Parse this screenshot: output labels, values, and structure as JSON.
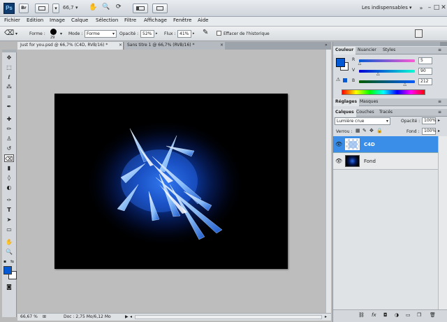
{
  "app": {
    "logo_text": "Ps"
  },
  "appbar": {
    "zoom": "66,7",
    "workspace": "Les indispensables"
  },
  "menu": [
    "Fichier",
    "Edition",
    "Image",
    "Calque",
    "Sélection",
    "Filtre",
    "Affichage",
    "Fenêtre",
    "Aide"
  ],
  "options": {
    "forme_label": "Forme :",
    "brush_size": "29",
    "mode_label": "Mode :",
    "mode_value": "Forme",
    "opacite_label": "Opacité :",
    "opacite_value": "52%",
    "flux_label": "Flux :",
    "flux_value": "41%",
    "historique_label": "Effacer de l'historique"
  },
  "tabs": [
    {
      "label": "Just for you.psd @ 66,7% (C4D, RVB/16) *",
      "active": true
    },
    {
      "label": "Sans titre 1 @ 66,7% (RVB/16) *",
      "active": false
    }
  ],
  "status": {
    "zoom": "66,67 %",
    "doc": "Doc : 2,75 Mo/6,12 Mo"
  },
  "color_panel": {
    "tabs": [
      "Couleur",
      "Nuancier",
      "Styles"
    ],
    "r_label": "R",
    "v_label": "V",
    "b_label": "B",
    "r": "5",
    "v": "90",
    "b": "212",
    "r_level": 0.02,
    "v_level": 0.35,
    "b_level": 0.83,
    "foreground": "#055ad4",
    "background": "#ffffff"
  },
  "adjust_panel": {
    "tabs": [
      "Réglages",
      "Masques"
    ]
  },
  "layers_panel": {
    "tabs": [
      "Calques",
      "Couches",
      "Tracés"
    ],
    "blend_mode": "Lumière crue",
    "opacity_label": "Opacité :",
    "opacity": "100%",
    "lock_label": "Verrou :",
    "fill_label": "Fond :",
    "fill": "100%",
    "layers": [
      {
        "name": "C4D",
        "selected": true
      },
      {
        "name": "Fond",
        "selected": false
      }
    ]
  }
}
